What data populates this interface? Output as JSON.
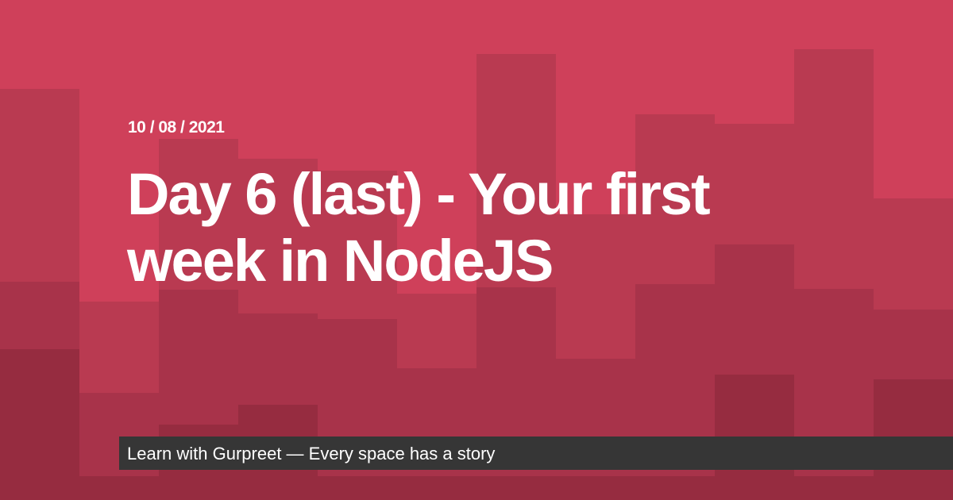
{
  "post": {
    "date": "10 / 08 / 2021",
    "title": "Day 6 (last) - Your first week in NodeJS"
  },
  "footer": {
    "text": "Learn with Gurpreet — Every space has a story"
  },
  "colors": {
    "background": "#cf405a",
    "shade1": "#b93a51",
    "shade2": "#a8334a",
    "shade3": "#962c40",
    "footer_bar": "#363636",
    "text": "#ffffff"
  }
}
